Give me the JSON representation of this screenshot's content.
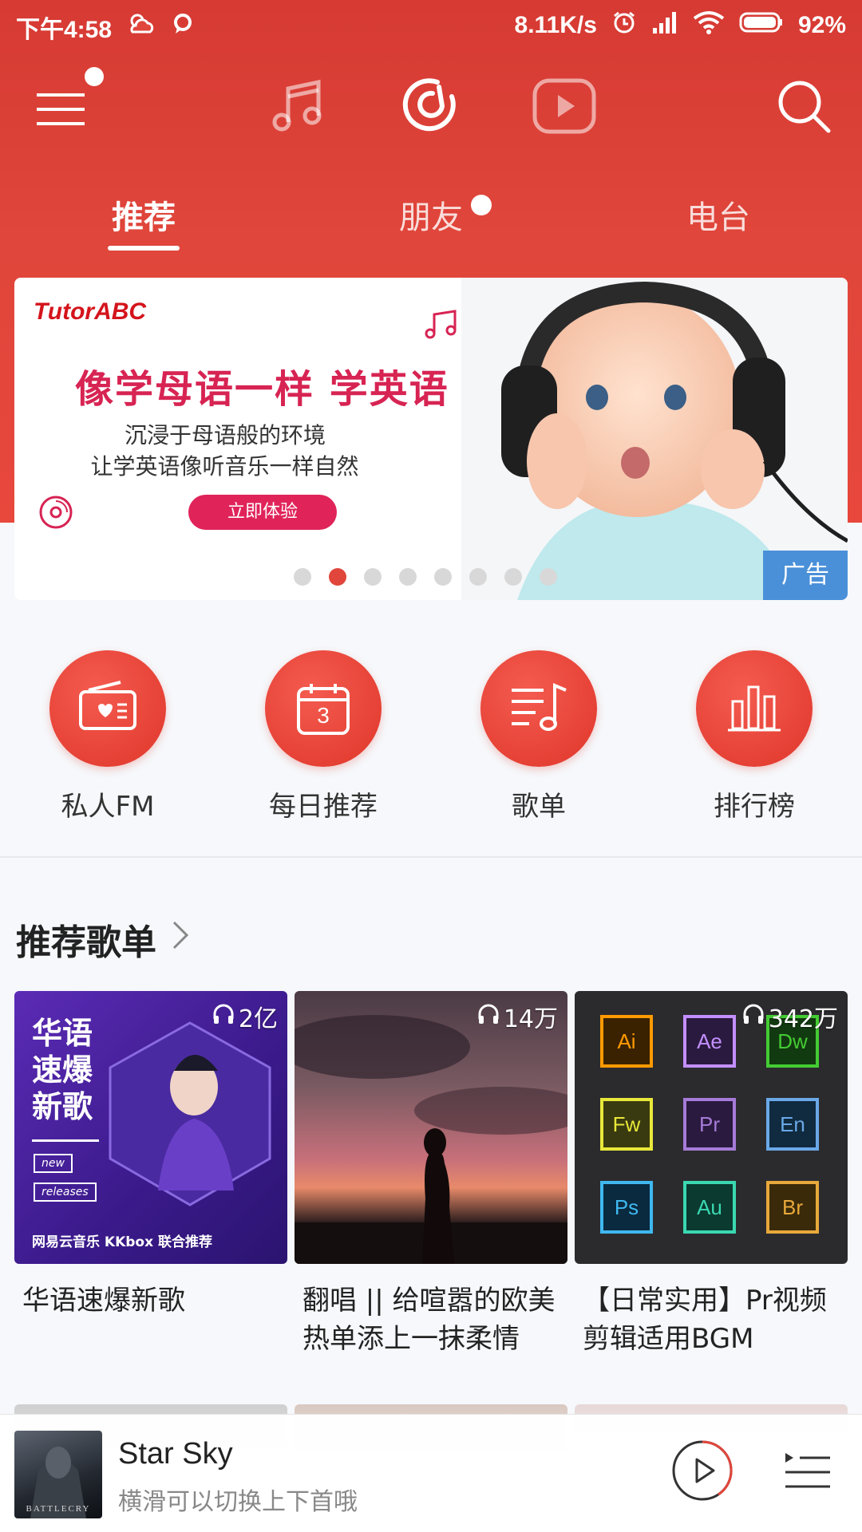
{
  "status_bar": {
    "time": "下午4:58",
    "network_speed": "8.11K/s",
    "battery": "92%"
  },
  "top_nav": {
    "icons": [
      "menu-icon",
      "music-note-icon",
      "netease-logo-icon",
      "video-icon",
      "search-icon"
    ]
  },
  "tabs": [
    {
      "label": "推荐",
      "active": true
    },
    {
      "label": "朋友",
      "active": false
    },
    {
      "label": "电台",
      "active": false
    }
  ],
  "banner": {
    "brand": "TutorABC",
    "headline": "像学母语一样 学英语",
    "sub_line1": "沉浸于母语般的环境",
    "sub_line2": "让学英语像听音乐一样自然",
    "cta": "立即体验",
    "ad_tag": "广告",
    "page_count": 8,
    "active_page": 2
  },
  "shortcuts": [
    {
      "label": "私人FM",
      "icon": "radio-heart-icon"
    },
    {
      "label": "每日推荐",
      "icon": "calendar-icon",
      "calendar_day": "3"
    },
    {
      "label": "歌单",
      "icon": "playlist-icon"
    },
    {
      "label": "排行榜",
      "icon": "chart-bars-icon"
    }
  ],
  "section": {
    "title": "推荐歌单"
  },
  "playlists": [
    {
      "plays": "2亿",
      "title": "华语速爆新歌",
      "cover_text": [
        "华语",
        "速爆",
        "新歌"
      ],
      "cover_tags": [
        "new",
        "releases"
      ],
      "cover_footer": "网易云音乐 KKbox 联合推荐"
    },
    {
      "plays": "14万",
      "title_line1": "翻唱 || 给喧嚣的欧美",
      "title_line2": "热单添上一抹柔情"
    },
    {
      "plays": "342万",
      "title_line1": "【日常实用】Pr视频",
      "title_line2": "剪辑适用BGM",
      "tiles": [
        "Ai",
        "Ae",
        "Dw",
        "Fw",
        "Pr",
        "En",
        "Ps",
        "Au",
        "Br"
      ]
    }
  ],
  "player": {
    "song": "Star Sky",
    "hint": "横滑可以切换上下首哦",
    "art_caption": "BATTLECRY"
  },
  "colors": {
    "primary_red": "#e0463b",
    "ad_blue": "#4a90d9",
    "banner_pink": "#d72453"
  }
}
